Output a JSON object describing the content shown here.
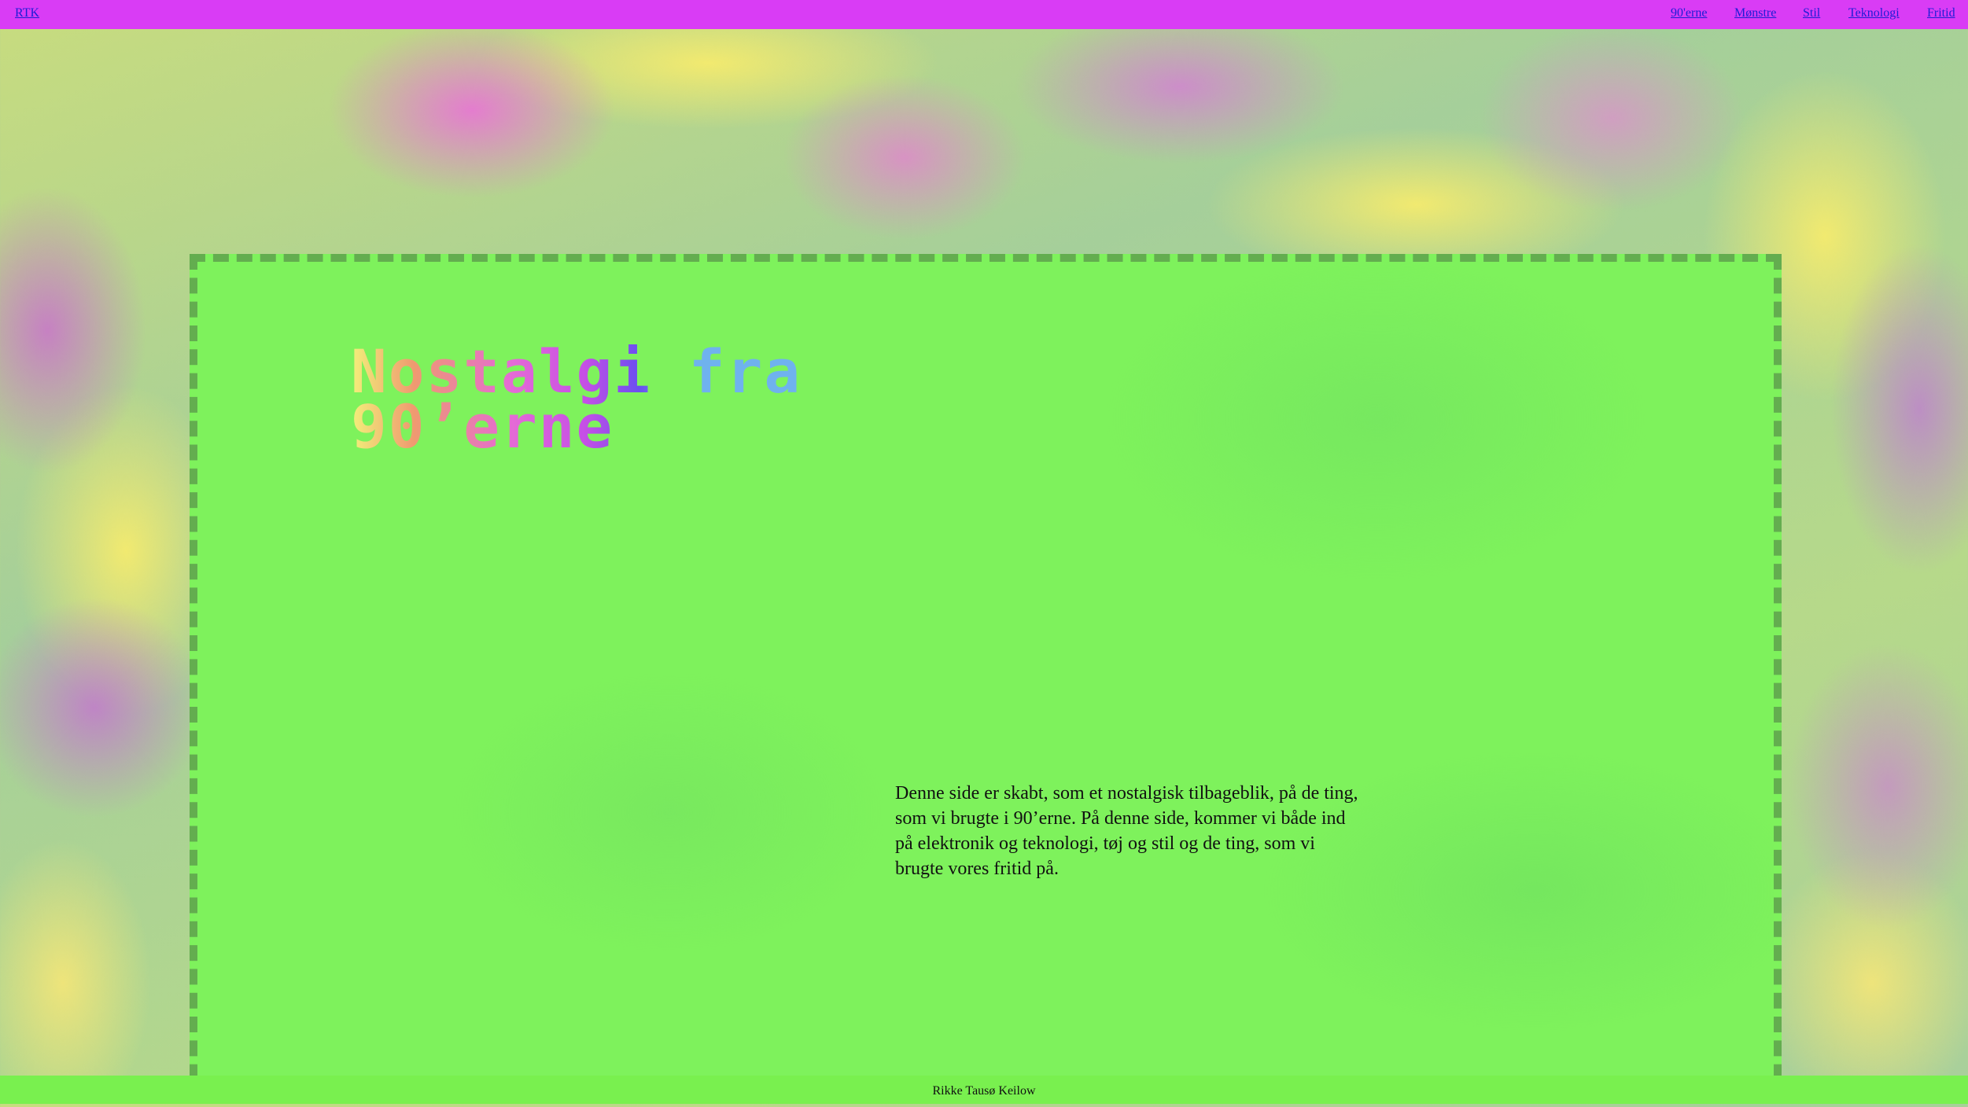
{
  "nav": {
    "brand": "RTK",
    "links": [
      "90'erne",
      "Mønstre",
      "Stil",
      "Teknologi",
      "Fritid"
    ]
  },
  "hero": {
    "title": "Nostalgi fra\n90’erne",
    "intro": "Denne side er skabt, som et nostalgisk tilbageblik, på de ting, som vi brugte i 90’erne. På denne side, kommer vi både ind på elektronik og teknologi, tøj og stil og de ting, som vi brugte vores fritid på."
  },
  "footer": {
    "author": "Rikke Tausø Keilow"
  },
  "colors": {
    "nav_bar": "#d93cf5",
    "link": "#1d1dd6",
    "card": "#7ef25c",
    "card_border": "#63ad4f",
    "footer": "#79f04f"
  }
}
